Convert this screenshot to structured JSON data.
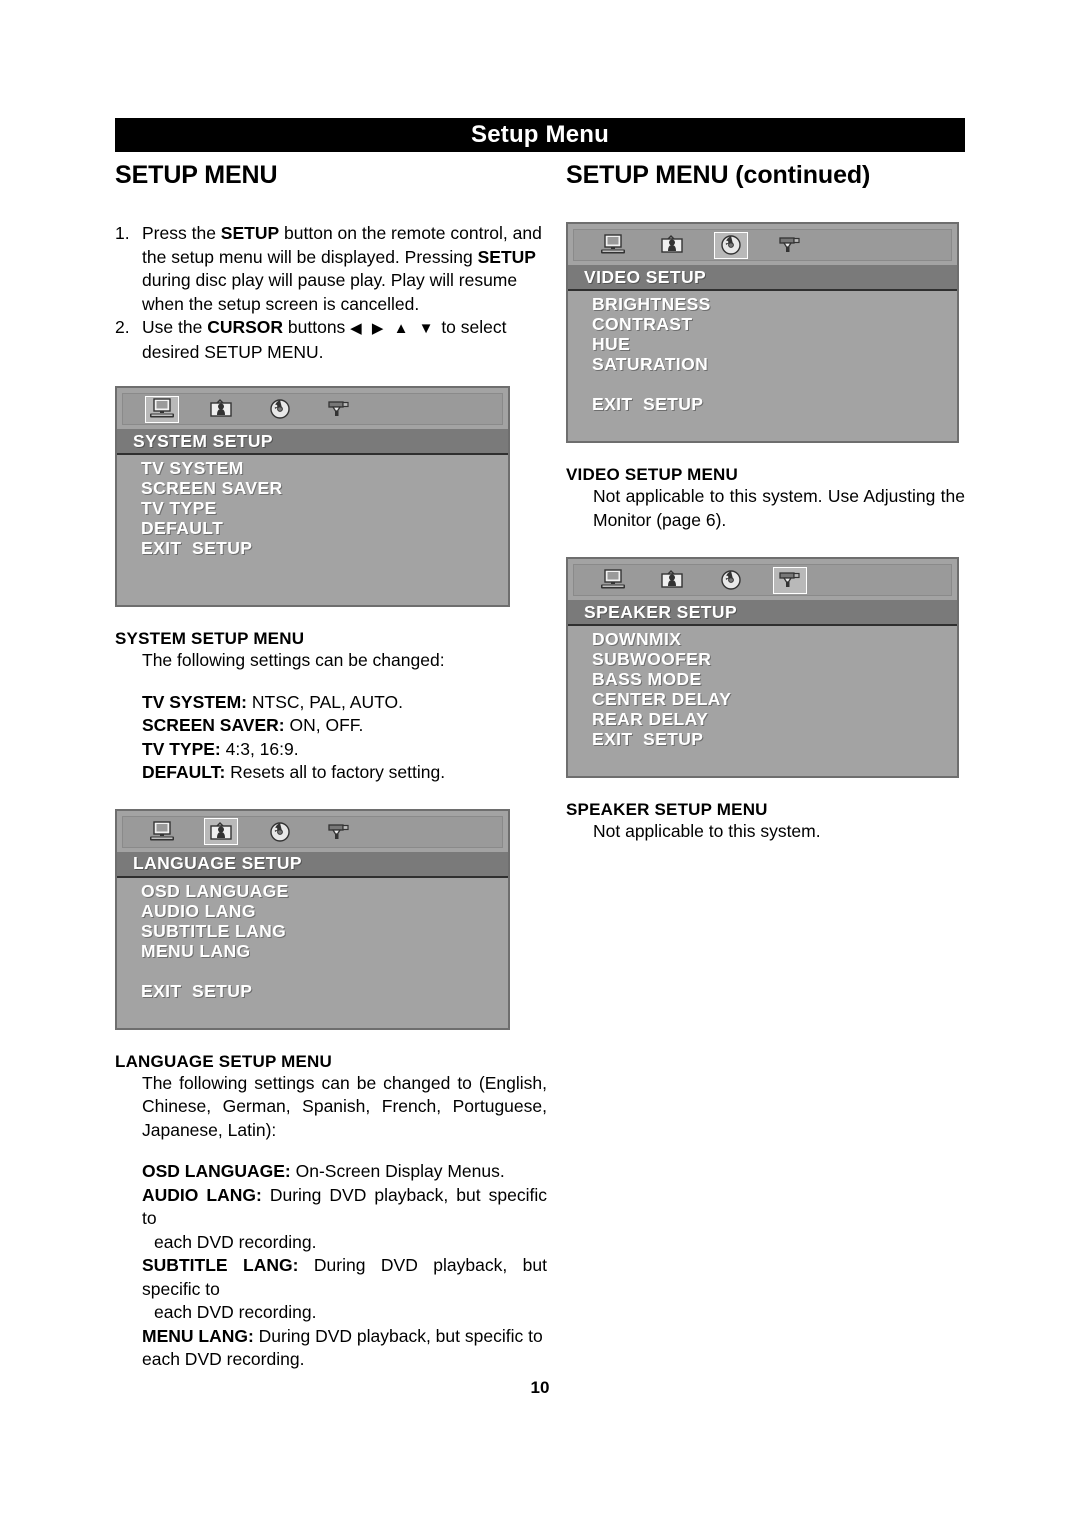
{
  "header": {
    "title": "Setup Menu"
  },
  "page_number": "10",
  "left": {
    "heading": "SETUP MENU",
    "steps": [
      {
        "num": "1.",
        "parts": [
          {
            "t": "Press the ",
            "b": false
          },
          {
            "t": "SETUP",
            "b": true
          },
          {
            "t": " button on the remote control, and the setup menu will be displayed. Pressing ",
            "b": false
          },
          {
            "t": "SETUP",
            "b": true
          },
          {
            "t": " during disc play will pause play. Play will resume when the setup screen is cancelled.",
            "b": false
          }
        ]
      },
      {
        "num": "2.",
        "parts": [
          {
            "t": "Use the ",
            "b": false
          },
          {
            "t": "CURSOR",
            "b": true
          },
          {
            "t": " buttons ",
            "b": false
          },
          {
            "t": "◀ ▶ ▲ ▼",
            "b": false,
            "arrows": true
          },
          {
            "t": "  to select desired SETUP MENU.",
            "b": false
          }
        ]
      }
    ],
    "system_osd": {
      "selected_icon": 0,
      "title": "SYSTEM SETUP",
      "items": [
        "TV SYSTEM",
        "SCREEN SAVER",
        "TV TYPE",
        "DEFAULT",
        "EXIT  SETUP"
      ]
    },
    "system_section": {
      "heading": "SYSTEM SETUP MENU",
      "intro": "The following settings can be changed:",
      "defs": [
        {
          "term": "TV SYSTEM:",
          "desc": " NTSC, PAL, AUTO."
        },
        {
          "term": "SCREEN SAVER:",
          "desc": " ON, OFF."
        },
        {
          "term": "TV TYPE:",
          "desc": " 4:3, 16:9."
        },
        {
          "term": "DEFAULT:",
          "desc": " Resets all to factory setting."
        }
      ]
    },
    "language_osd": {
      "selected_icon": 1,
      "title": "LANGUAGE SETUP",
      "items": [
        "OSD LANGUAGE",
        "AUDIO LANG",
        "SUBTITLE LANG",
        "MENU LANG",
        "",
        "EXIT  SETUP"
      ]
    },
    "language_section": {
      "heading": "LANGUAGE SETUP MENU",
      "intro": "The following settings can be changed to (English, Chinese, German, Spanish, French, Portuguese, Japanese, Latin):",
      "defs": [
        {
          "term": "OSD LANGUAGE:",
          "desc": " On-Screen Display Menus.",
          "wrap": ""
        },
        {
          "term": "AUDIO LANG:",
          "desc": " During DVD playback, but specific to",
          "wrap": "each DVD recording."
        },
        {
          "term": "SUBTITLE LANG:",
          "desc": " During DVD playback, but specific to",
          "wrap": "each DVD recording."
        },
        {
          "term": "MENU LANG:",
          "desc": " During DVD playback, but specific to",
          "wrap": "each DVD recording."
        }
      ]
    }
  },
  "right": {
    "heading_main": "SETUP MENU",
    "heading_cont": " (continued)",
    "video_osd": {
      "selected_icon": 2,
      "title": "VIDEO SETUP",
      "items": [
        "BRIGHTNESS",
        "CONTRAST",
        "HUE",
        "SATURATION",
        "",
        "EXIT  SETUP"
      ]
    },
    "video_section": {
      "heading": "VIDEO SETUP MENU",
      "body": "Not applicable to this system. Use Adjusting the Monitor (page 6)."
    },
    "speaker_osd": {
      "selected_icon": 3,
      "title": "SPEAKER SETUP",
      "items": [
        "DOWNMIX",
        "SUBWOOFER",
        "BASS MODE",
        "CENTER DELAY",
        "REAR DELAY",
        "EXIT  SETUP"
      ]
    },
    "speaker_section": {
      "heading": "SPEAKER SETUP MENU",
      "body": "Not applicable to this system."
    }
  },
  "icons": [
    "monitor-icon",
    "language-card-icon",
    "disc-icon",
    "speaker-icon"
  ],
  "colors": {
    "header_bg": "#000000",
    "osd_bg": "#a3a3a3",
    "osd_title_bg": "#7a7a7a",
    "osd_text": "#ffffff"
  }
}
